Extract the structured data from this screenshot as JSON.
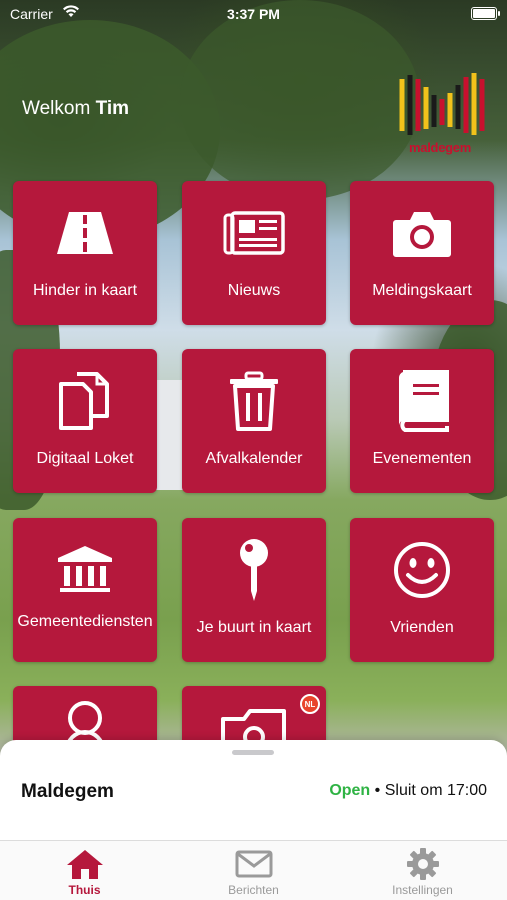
{
  "status_bar": {
    "carrier": "Carrier",
    "time": "3:37 PM"
  },
  "header": {
    "welcome_prefix": "Welkom",
    "user_name": "Tim",
    "logo_text": "maldegem"
  },
  "tiles": [
    {
      "label": "Hinder in kaart",
      "icon": "road-icon"
    },
    {
      "label": "Nieuws",
      "icon": "newspaper-icon"
    },
    {
      "label": "Meldingskaart",
      "icon": "camera-icon"
    },
    {
      "label": "Digitaal Loket",
      "icon": "documents-icon"
    },
    {
      "label": "Afvalkalender",
      "icon": "trash-icon"
    },
    {
      "label": "Evenementen",
      "icon": "book-icon"
    },
    {
      "label": "Gemeentediensten",
      "icon": "building-icon"
    },
    {
      "label": "Je buurt in kaart",
      "icon": "map-pin-icon"
    },
    {
      "label": "Vrienden",
      "icon": "smiley-icon"
    },
    {
      "label": "",
      "icon": "person-icon"
    },
    {
      "label": "",
      "icon": "photo-folder-icon",
      "badge": "NL"
    }
  ],
  "sheet": {
    "place": "Maldegem",
    "status": "Open",
    "separator": "•",
    "closing": "Sluit om 17:00"
  },
  "tabbar": [
    {
      "label": "Thuis",
      "icon": "home-icon",
      "active": true
    },
    {
      "label": "Berichten",
      "icon": "mail-icon",
      "active": false
    },
    {
      "label": "Instellingen",
      "icon": "gear-icon",
      "active": false
    }
  ],
  "colors": {
    "tile": "#b5183c",
    "open": "#2fb344",
    "active_tab": "#b5183c",
    "inactive_tab": "#9a9a9a"
  }
}
